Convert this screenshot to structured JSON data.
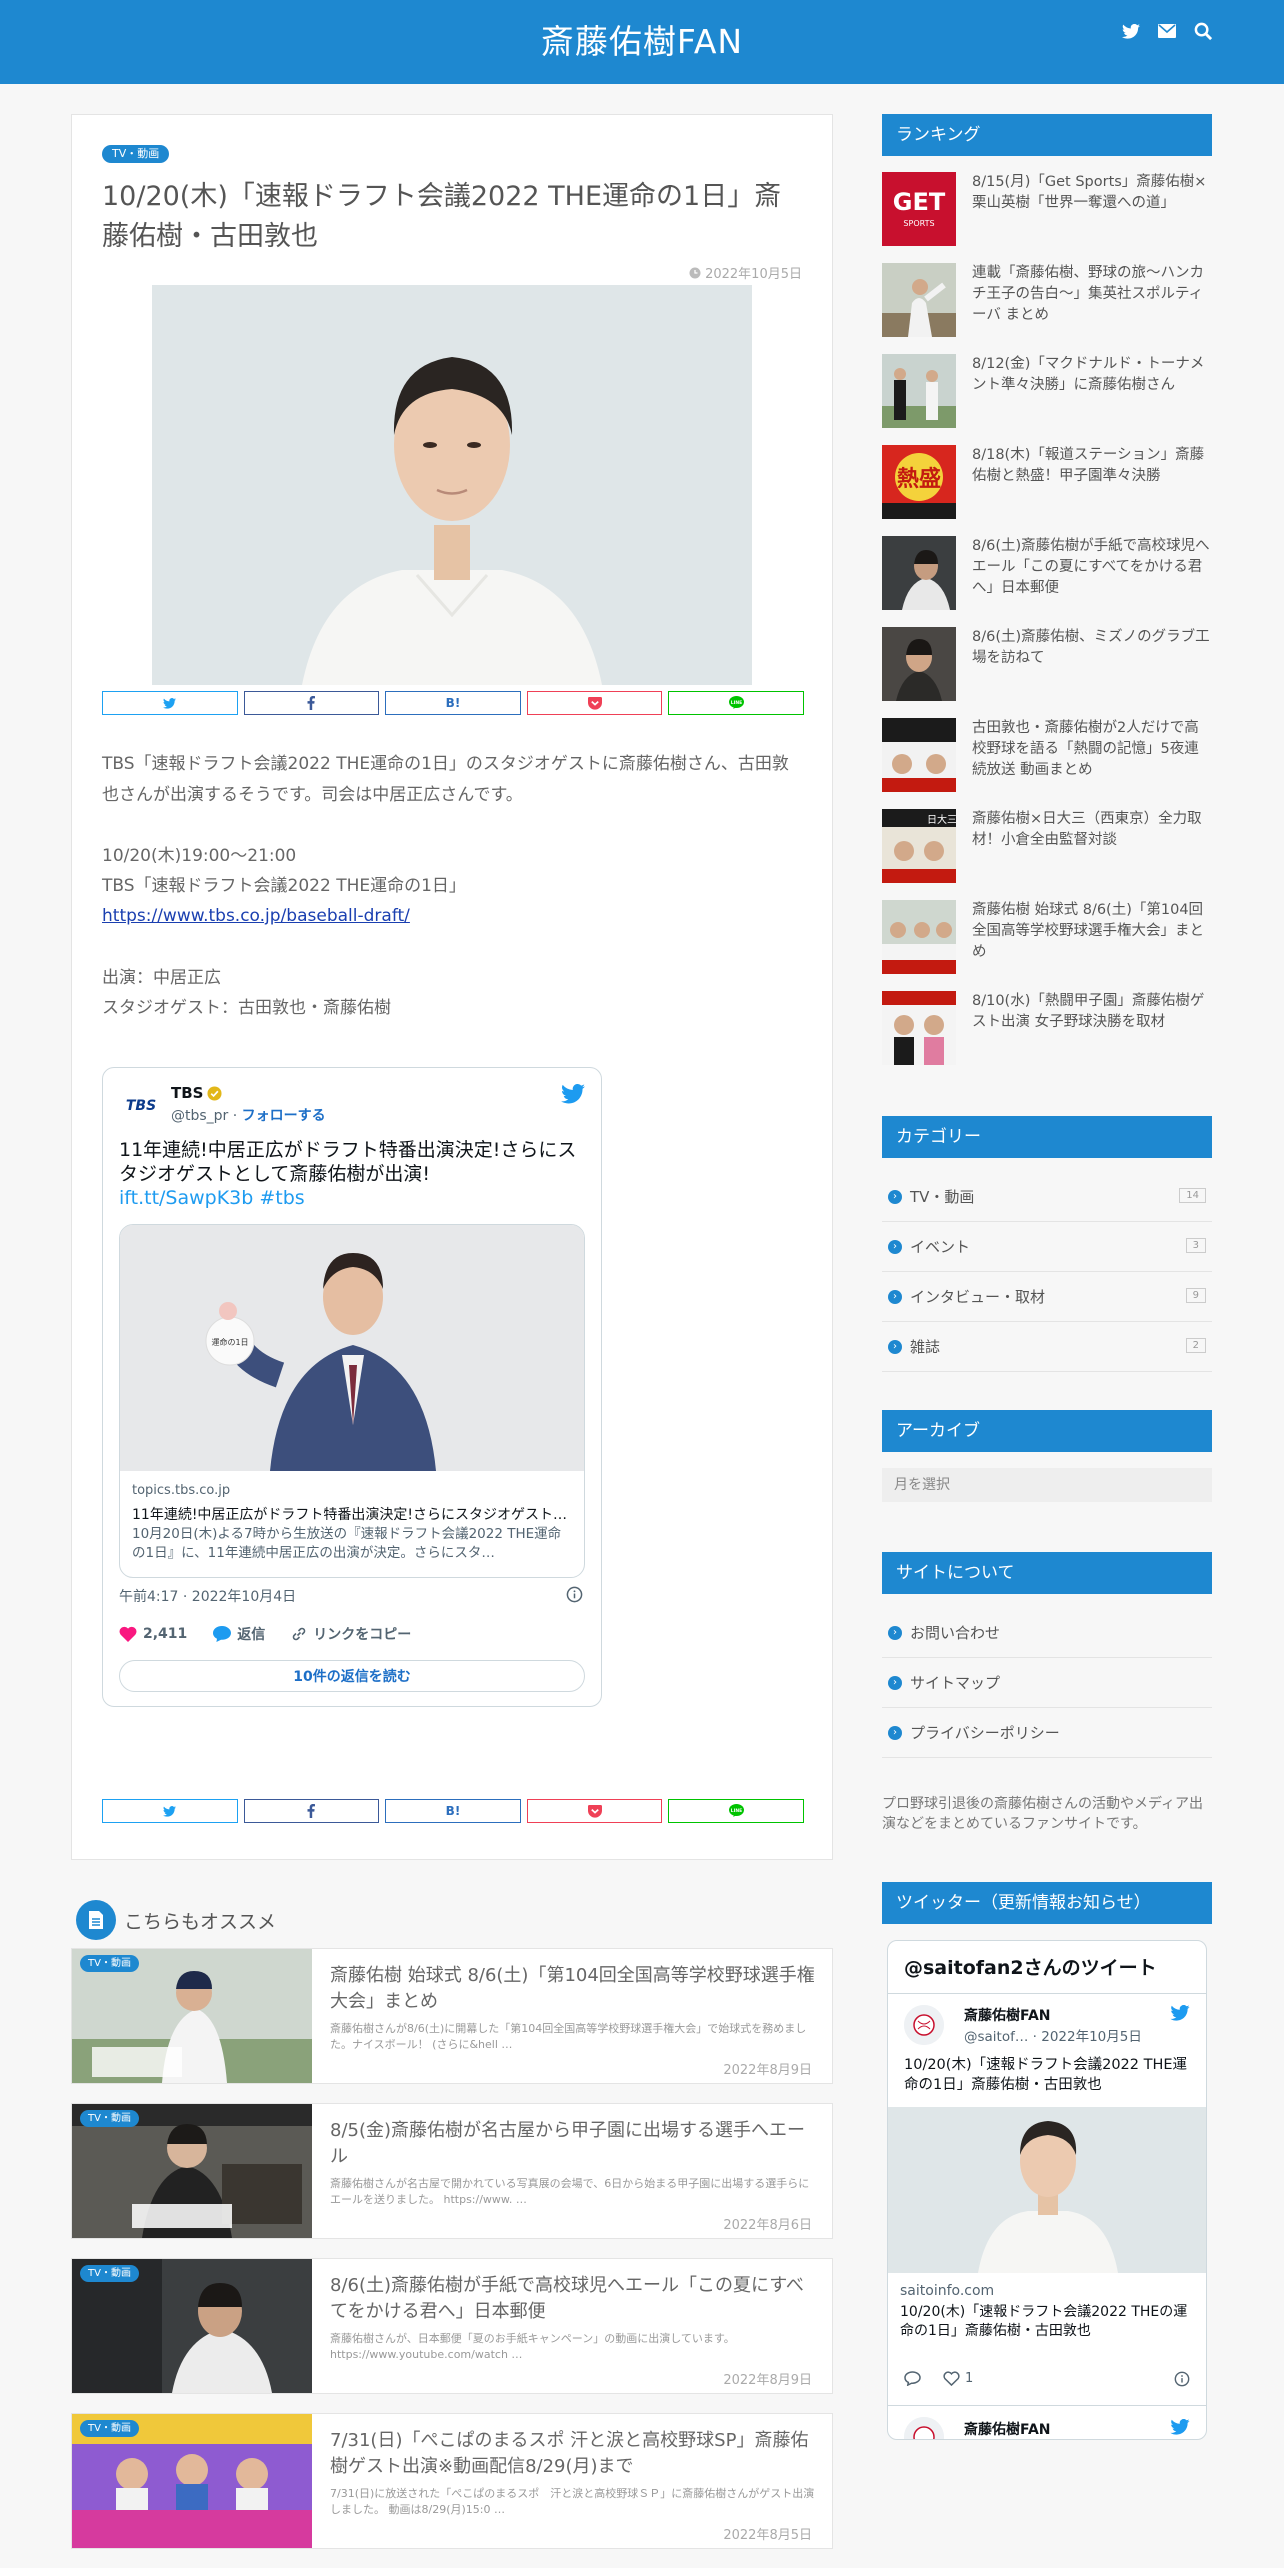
{
  "header": {
    "site_title": "斎藤佑樹FAN",
    "icons": [
      "twitter-icon",
      "mail-icon",
      "search-icon"
    ]
  },
  "article": {
    "category": "TV・動画",
    "title": "10/20(木)「速報ドラフト会議2022 THE運命の1日」斎藤佑樹・古田敦也",
    "date": "2022年10月5日",
    "share": {
      "hatena": "B!"
    },
    "intro": "TBS「速報ドラフト会議2022 THE運命の1日」のスタジオゲストに斎藤佑樹さん、古田敦也さんが出演するそうです。司会は中居正広さんです。",
    "schedule_time": "10/20(木)19:00～21:00",
    "schedule_program": "TBS「速報ドラフト会議2022 THE運命の1日」",
    "schedule_url": "https://www.tbs.co.jp/baseball-draft/",
    "cast_host": "出演：中居正広",
    "cast_guest": "スタジオゲスト：古田敦也・斎藤佑樹"
  },
  "tweet": {
    "logo": "TBS",
    "name": "TBS",
    "handle": "@tbs_pr",
    "separator": "·",
    "follow": "フォローする",
    "text": "11年連続!中居正広がドラフト特番出演決定!さらにスタジオゲストとして斎藤佑樹が出演!",
    "link": "ift.tt/SawpK3b #tbs",
    "card_ball_text": "運命の1日",
    "card_domain": "topics.tbs.co.jp",
    "card_title": "11年連続!中居正広がドラフト特番出演決定!さらにスタジオゲスト…",
    "card_desc": "10月20日(木)よる7時から生放送の『速報ドラフト会議2022 THE運命の1日』に、11年連続中居正広の出演が決定。さらにスタ…",
    "time": "午前4:17 · 2022年10月4日",
    "likes": "2,411",
    "reply": "返信",
    "copy_link": "リンクをコピー",
    "read_replies": "10件の返信を読む"
  },
  "recommend": {
    "heading": "こちらもオススメ",
    "items": [
      {
        "badge": "TV・動画",
        "title": "斎藤佑樹 始球式 8/6(土)「第104回全国高等学校野球選手権大会」まとめ",
        "excerpt": "斎藤佑樹さんが8/6(土)に開幕した「第104回全国高等学校野球選手権大会」で始球式を務めました。ナイスボール！ (さらに&hell …",
        "date": "2022年8月9日"
      },
      {
        "badge": "TV・動画",
        "title": "8/5(金)斎藤佑樹が名古屋から甲子園に出場する選手へエール",
        "excerpt": "斎藤佑樹さんが名古屋で開かれている写真展の会場で、6日から始まる甲子園に出場する選手らにエールを送りました。 https://www. …",
        "date": "2022年8月6日"
      },
      {
        "badge": "TV・動画",
        "title": "8/6(土)斎藤佑樹が手紙で高校球児へエール「この夏にすべてをかける君へ」日本郵便",
        "excerpt": "斎藤佑樹さんが、日本郵便「夏のお手紙キャンペーン」の動画に出演しています。 https://www.youtube.com/watch …",
        "date": "2022年8月9日"
      },
      {
        "badge": "TV・動画",
        "title": "7/31(日)「ぺこぱのまるスポ 汗と涙と高校野球SP」斎藤佑樹ゲスト出演※動画配信8/29(月)まで",
        "excerpt": "7/31(日)に放送された「ぺこぱのまるスポ　汗と涙と高校野球ＳＰ」に斎藤佑樹さんがゲスト出演しました。 動画は8/29(月)15:0 …",
        "date": "2022年8月5日"
      }
    ]
  },
  "sidebar": {
    "ranking_title": "ランキング",
    "ranking": [
      "8/15(月)「Get Sports」斎藤佑樹×栗山英樹「世界一奪還への道」",
      "連載「斎藤佑樹、野球の旅～ハンカチ王子の告白～」集英社スポルティーバ まとめ",
      "8/12(金)「マクドナルド・トーナメント準々決勝」に斎藤佑樹さん",
      "8/18(木)「報道ステーション」斎藤佑樹と熱盛！甲子園準々決勝",
      "8/6(土)斎藤佑樹が手紙で高校球児へエール「この夏にすべてをかける君へ」日本郵便",
      "8/6(土)斎藤佑樹、ミズノのグラブ工場を訪ねて",
      "古田敦也・斎藤佑樹が2人だけで高校野球を語る「熱闘の記憶」5夜連続放送 動画まとめ",
      "斎藤佑樹×日大三（西東京）全力取材！小倉全由監督対談",
      "斎藤佑樹 始球式 8/6(土)「第104回全国高等学校野球選手権大会」まとめ",
      "8/10(水)「熱闘甲子園」斎藤佑樹ゲスト出演 女子野球決勝を取材"
    ],
    "thumb_texts": {
      "getsports": "GET",
      "getsports_sub": "SPORTS",
      "netsumori": "熱盛",
      "nichidai": "日大三"
    },
    "category_title": "カテゴリー",
    "categories": [
      {
        "label": "TV・動画",
        "count": "14"
      },
      {
        "label": "イベント",
        "count": "3"
      },
      {
        "label": "インタビュー・取材",
        "count": "9"
      },
      {
        "label": "雑誌",
        "count": "2"
      }
    ],
    "archive_title": "アーカイブ",
    "archive_placeholder": "月を選択",
    "about_title": "サイトについて",
    "about_links": [
      "お問い合わせ",
      "サイトマップ",
      "プライバシーポリシー"
    ],
    "about_text": "プロ野球引退後の斎藤佑樹さんの活動やメディア出演などをまとめているファンサイトです。",
    "twitter_title": "ツイッター（更新情報お知らせ）"
  },
  "timeline": {
    "heading": "@saitofan2さんのツイート",
    "name": "斎藤佑樹FAN",
    "handle": "@saitof… · 2022年10月5日",
    "text": "10/20(木)「速報ドラフト会議2022 THE運命の1日」斎藤佑樹・古田敦也",
    "domain": "saitoinfo.com",
    "card_title": "10/20(木)「速報ドラフト会議2022 THEの運命の1日」斎藤佑樹・古田敦也",
    "likes": "1",
    "name2": "斎藤佑樹FAN"
  },
  "colors": {
    "brand": "#1e88d0",
    "twitter": "#1d9bf0",
    "like": "#f91880"
  }
}
